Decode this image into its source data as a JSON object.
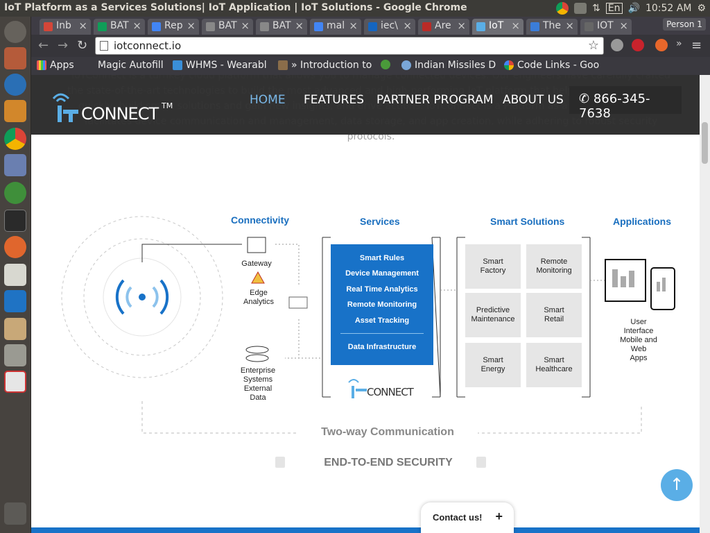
{
  "window": {
    "title": "IoT Platform as a Services Solutions| IoT Application | IoT Solutions - Google Chrome"
  },
  "system": {
    "keyboard": "En",
    "time": "10:52 AM"
  },
  "tabs": [
    {
      "label": "Inb",
      "icon": "gmail-icon",
      "color": "#d44638"
    },
    {
      "label": "BAT",
      "icon": "sheets-icon",
      "color": "#0f9d58"
    },
    {
      "label": "Rep",
      "icon": "docs-icon",
      "color": "#4285f4"
    },
    {
      "label": "BAT",
      "icon": "drive-icon",
      "color": "#888888"
    },
    {
      "label": "BAT",
      "icon": "drive-icon",
      "color": "#888888"
    },
    {
      "label": "mal",
      "icon": "google-icon",
      "color": "#4285f4"
    },
    {
      "label": "iec\\",
      "icon": "iec-icon",
      "color": "#1565c0"
    },
    {
      "label": "Are",
      "icon": "quora-icon",
      "color": "#b92b27"
    },
    {
      "label": "IoT",
      "icon": "iotconnect-icon",
      "color": "#5aaee6",
      "active": true
    },
    {
      "label": "The",
      "icon": "s-icon",
      "color": "#3b7dd8"
    },
    {
      "label": "IOT",
      "icon": "blank-icon",
      "color": "#666666"
    }
  ],
  "profile": {
    "label": "Person 1"
  },
  "omnibox": {
    "url": "iotconnect.io"
  },
  "bookmarks": [
    {
      "label": "Apps",
      "icon": "apps-grid-icon"
    },
    {
      "label": "Magic Autofill",
      "icon": "blank-icon"
    },
    {
      "label": "WHMS - Wearabl",
      "icon": "whms-icon"
    },
    {
      "label": "» Introduction to",
      "icon": "book-icon"
    },
    {
      "label": "",
      "icon": "leaf-icon"
    },
    {
      "label": "Indian Missiles D",
      "icon": "globe-icon"
    },
    {
      "label": "Code Links - Goo",
      "icon": "google-icon"
    }
  ],
  "site": {
    "hero_text": "IoTConnect is a turnkey cloud platform that allows you to manage connected devices. Our engineers have carefully crafted the state-of-the-art technologies to build the most advanced and high-performing IoT platform that helps you connect things quickly, build smart solutions and gain new insights, and drive actions. IoTConnect is a Platform as a Service (PaaS) that facilitates device communication and management, data storage, and app creation, while adhering to robust security protocols.",
    "logo_text": "CONNECT",
    "logo_tm": "TM",
    "nav": [
      {
        "label": "HOME",
        "active": true
      },
      {
        "label": "FEATURES"
      },
      {
        "label": "PARTNER PROGRAM"
      },
      {
        "label": "ABOUT US"
      }
    ],
    "phone": "866-345-7638"
  },
  "diagram": {
    "headings": {
      "connectivity": "Connectivity",
      "services": "Services",
      "smart_solutions": "Smart Solutions",
      "applications": "Applications"
    },
    "gateway": "Gateway",
    "edge_analytics": "Edge\nAnalytics",
    "enterprise": "Enterprise\nSystems\nExternal\nData",
    "services": [
      "Smart Rules",
      "Device Management",
      "Real Time Analytics",
      "Remote Monitoring",
      "Asset Tracking"
    ],
    "data_infrastructure": "Data Infrastructure",
    "services_logo": "CONNECT",
    "solutions": [
      "Smart\nFactory",
      "Remote\nMonitoring",
      "Predictive\nMaintenance",
      "Smart\nRetail",
      "Smart\nEnergy",
      "Smart\nHealthcare"
    ],
    "applications_text": "User\nInterface\nMobile and\nWeb\nApps",
    "two_way": "Two-way Communication",
    "security": "END-TO-END SECURITY"
  },
  "contact": {
    "label": "Contact us!"
  },
  "colors": {
    "brand_blue": "#1872c8",
    "nav_active": "#7ab8e8",
    "heading_blue": "#1a6fbf"
  }
}
